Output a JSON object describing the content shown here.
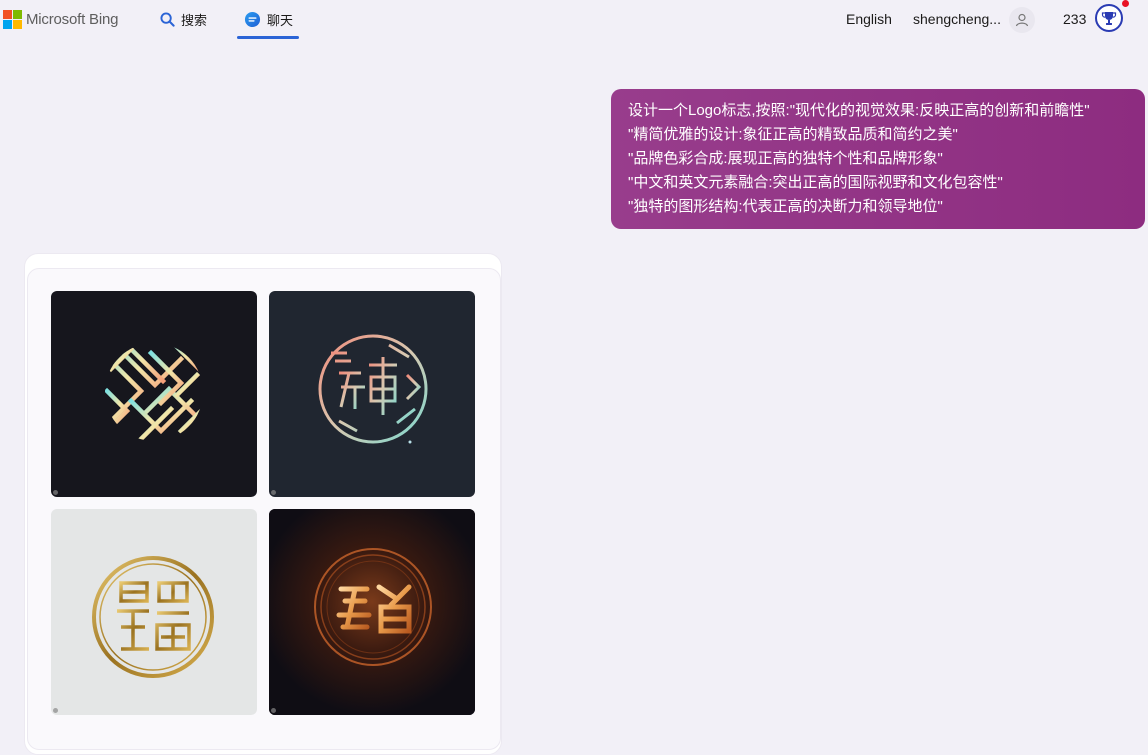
{
  "header": {
    "logo_text": "Microsoft Bing",
    "tabs": [
      {
        "label": "搜索",
        "icon": "search-icon"
      },
      {
        "label": "聊天",
        "icon": "chat-icon",
        "active": true
      }
    ],
    "language": "English",
    "username": "shengcheng...",
    "points": "233"
  },
  "message": {
    "lines": [
      "设计一个Logo标志,按照:\"现代化的视觉效果:反映正高的创新和前瞻性\"",
      "\"精简优雅的设计:象征正高的精致品质和简约之美\"",
      "\"品牌色彩合成:展现正高的独特个性和品牌形象\"",
      "\"中文和英文元素融合:突出正高的国际视野和文化包容性\"",
      "\"独特的图形结构:代表正高的决断力和领导地位\""
    ]
  },
  "images": [
    {
      "name": "generated-image-1",
      "style": "pastel-maze-circle"
    },
    {
      "name": "generated-image-2",
      "style": "gradient-glyph-circle"
    },
    {
      "name": "generated-image-3",
      "style": "gold-seal-light"
    },
    {
      "name": "generated-image-4",
      "style": "glowing-copper-glyph"
    }
  ],
  "colors": {
    "accent": "#2b64d6",
    "message_bg": "#923486",
    "page_bg": "#f2f0f7"
  }
}
